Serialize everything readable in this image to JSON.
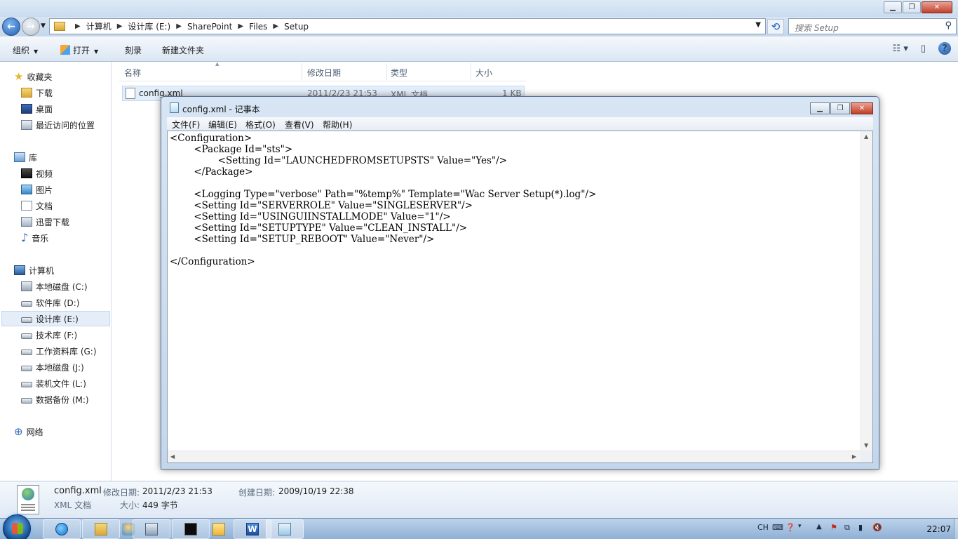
{
  "explorer": {
    "breadcrumb": [
      "计算机",
      "设计库 (E:)",
      "SharePoint",
      "Files",
      "Setup"
    ],
    "search_placeholder": "搜索 Setup",
    "toolbar": {
      "organize": "组织",
      "open": "打开",
      "burn": "刻录",
      "new_folder": "新建文件夹"
    },
    "sidebar": {
      "favorites": "收藏夹",
      "downloads": "下载",
      "desktop": "桌面",
      "recent": "最近访问的位置",
      "libraries": "库",
      "videos": "视频",
      "pictures": "图片",
      "documents": "文档",
      "thunder": "迅雷下载",
      "music": "音乐",
      "computer": "计算机",
      "drive_c": "本地磁盘 (C:)",
      "drive_d": "软件库 (D:)",
      "drive_e": "设计库 (E:)",
      "drive_f": "技术库 (F:)",
      "drive_g": "工作资料库 (G:)",
      "drive_j": "本地磁盘 (J:)",
      "drive_l": "装机文件 (L:)",
      "drive_m": "数据备份 (M:)",
      "network": "网络"
    },
    "columns": {
      "name": "名称",
      "modified": "修改日期",
      "type": "类型",
      "size": "大小"
    },
    "file": {
      "name": "config.xml",
      "modified": "2011/2/23 21:53",
      "type": "XML 文档",
      "size": "1 KB"
    },
    "details": {
      "name": "config.xml",
      "modified_label": "修改日期:",
      "modified": "2011/2/23 21:53",
      "created_label": "创建日期:",
      "created": "2009/10/19 22:38",
      "type": "XML 文档",
      "size_label": "大小:",
      "size": "449 字节"
    }
  },
  "notepad": {
    "title": "config.xml - 记事本",
    "menu": [
      "文件(F)",
      "编辑(E)",
      "格式(O)",
      "查看(V)",
      "帮助(H)"
    ],
    "content": "<Configuration>\n\t<Package Id=\"sts\">\n\t\t<Setting Id=\"LAUNCHEDFROMSETUPSTS\" Value=\"Yes\"/>\n\t</Package>\n\n\t<Logging Type=\"verbose\" Path=\"%temp%\" Template=\"Wac Server Setup(*).log\"/>\n\t<Setting Id=\"SERVERROLE\" Value=\"SINGLESERVER\"/>\n\t<Setting Id=\"USINGUIINSTALLMODE\" Value=\"1\"/>\n\t<Setting Id=\"SETUPTYPE\" Value=\"CLEAN_INSTALL\"/>\n\t<Setting Id=\"SETUP_REBOOT\" Value=\"Never\"/>\n\n</Configuration>"
  },
  "taskbar": {
    "lang": "CH",
    "clock": "22:07",
    "word_letter": "W"
  }
}
